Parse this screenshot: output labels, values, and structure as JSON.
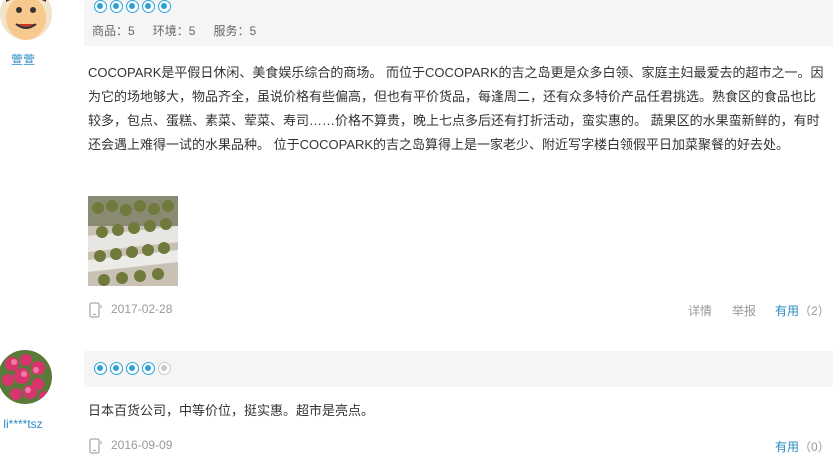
{
  "reviews": [
    {
      "username": "萱萱",
      "stars_filled": 5,
      "stars_total": 5,
      "scores": [
        {
          "label": "商品",
          "value": "5"
        },
        {
          "label": "环境",
          "value": "5"
        },
        {
          "label": "服务",
          "value": "5"
        }
      ],
      "text": "COCOPARK是平假日休闲、美食娱乐综合的商场。 而位于COCOPARK的吉之岛更是众多白领、家庭主妇最爱去的超市之一。因为它的场地够大，物品齐全，虽说价格有些偏高，但也有平价货品，每逢周二，还有众多特价产品任君挑选。熟食区的食品也比较多，包点、蛋糕、素菜、荤菜、寿司……价格不算贵，晚上七点多后还有打折活动，蛮实惠的。 蔬果区的水果蛮新鲜的，有时还会遇上难得一试的水果品种。 位于COCOPARK的吉之岛算得上是一家老少、附近写字楼白领假平日加菜聚餐的好去处。",
      "date": "2017-02-28",
      "detail_label": "详情",
      "report_label": "举报",
      "useful_label": "有用",
      "useful_count": "（2）"
    },
    {
      "username": "li****tsz",
      "stars_filled": 4,
      "stars_total": 5,
      "text": "日本百货公司，中等价位，挺实惠。超市是亮点。",
      "date": "2016-09-09",
      "useful_label": "有用",
      "useful_count": "（0）"
    }
  ],
  "icons": {
    "device": "mobile-phone-icon",
    "star": "circle-star-icon"
  },
  "colors": {
    "accent": "#2ba3d8",
    "link": "#2b8ac4",
    "muted": "#999999",
    "bar_bg": "#f5f5f5"
  }
}
